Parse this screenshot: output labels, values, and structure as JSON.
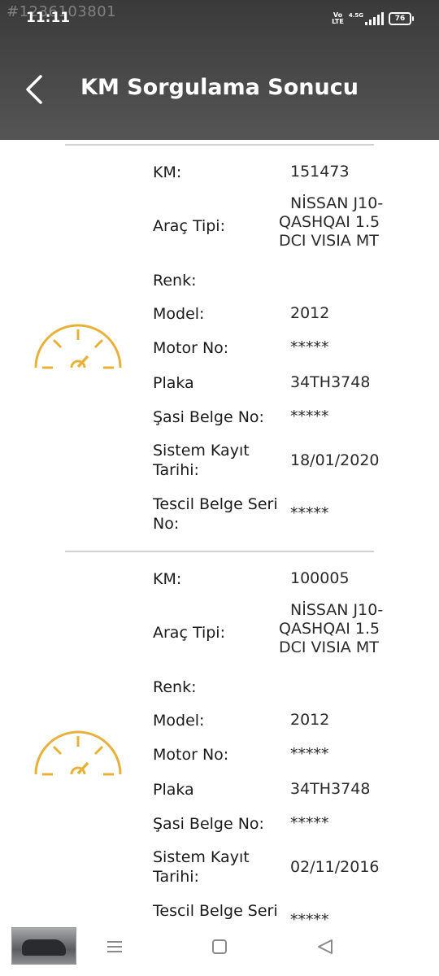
{
  "watermark": "#1236103801",
  "status": {
    "time": "11:11",
    "volte_line1": "Vo",
    "volte_line2": "LTE",
    "network": "4.5G",
    "battery": "76"
  },
  "header": {
    "title": "KM Sorgulama Sonucu"
  },
  "records": [
    {
      "km_label": "KM:",
      "km": "151473",
      "type_label": "Araç Tipi:",
      "type_lines": [
        "NİSSAN J10-",
        "QASHQAI 1.5",
        "DCI VISIA MT"
      ],
      "color_label": "Renk:",
      "color": "",
      "model_label": "Model:",
      "model": "2012",
      "engine_label": "Motor No:",
      "engine": "*****",
      "plate_label": "Plaka",
      "plate": "34TH3748",
      "chassis_label": "Şasi Belge No:",
      "chassis": "*****",
      "reg_date_label_1": "Sistem Kayıt",
      "reg_date_label_2": "Tarihi:",
      "reg_date": "18/01/2020",
      "serial_label_1": "Tescil Belge Seri",
      "serial_label_2": "No:",
      "serial": "*****"
    },
    {
      "km_label": "KM:",
      "km": "100005",
      "type_label": "Araç Tipi:",
      "type_lines": [
        "NİSSAN J10-",
        "QASHQAI 1.5",
        "DCI VISIA MT"
      ],
      "color_label": "Renk:",
      "color": "",
      "model_label": "Model:",
      "model": "2012",
      "engine_label": "Motor No:",
      "engine": "*****",
      "plate_label": "Plaka",
      "plate": "34TH3748",
      "chassis_label": "Şasi Belge No:",
      "chassis": "*****",
      "reg_date_label_1": "Sistem Kayıt",
      "reg_date_label_2": "Tarihi:",
      "reg_date": "02/11/2016",
      "serial_label_1": "Tescil Belge Seri",
      "serial_label_2": "",
      "serial": "*****"
    }
  ],
  "colors": {
    "header_bg": "#4a4a4a",
    "gauge": "#e8b23a",
    "divider": "#d0d0d0"
  },
  "icons": {
    "back": "chevron-left-icon",
    "gauge": "speedometer-icon",
    "recents": "menu-icon",
    "home": "square-icon",
    "nav_back": "triangle-back-icon"
  }
}
